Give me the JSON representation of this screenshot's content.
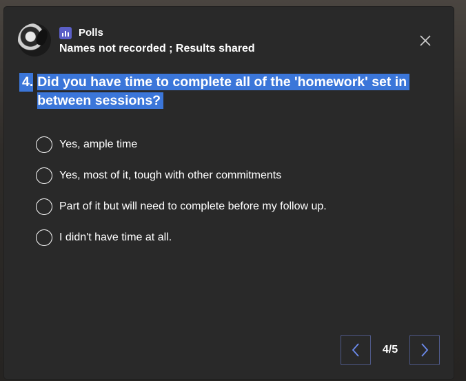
{
  "header": {
    "app_name": "Polls",
    "subtitle": "Names not recorded ; Results shared"
  },
  "icons": {
    "app": "polls-icon",
    "close": "close-icon",
    "prev": "chevron-left-icon",
    "next": "chevron-right-icon"
  },
  "colors": {
    "card_background": "#292929",
    "selection_highlight": "#3b76d9",
    "polls_icon": "#5b5fc7",
    "pager_border": "#4f5a8a"
  },
  "question": {
    "number": "4.",
    "text": "Did you have time to complete all of the 'homework' set in between sessions?"
  },
  "options": [
    {
      "label": "Yes, ample time",
      "selected": false
    },
    {
      "label": "Yes, most of it, tough with other commitments",
      "selected": false
    },
    {
      "label": "Part of it but will need to complete before my follow up.",
      "selected": false
    },
    {
      "label": "I didn't have time at all.",
      "selected": false
    }
  ],
  "pager": {
    "indicator": "4/5"
  }
}
